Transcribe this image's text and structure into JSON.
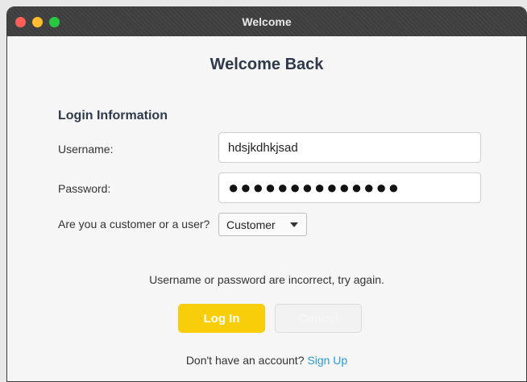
{
  "window": {
    "title": "Welcome",
    "controls": [
      "close",
      "minimize",
      "zoom"
    ]
  },
  "heading": "Welcome Back",
  "form": {
    "section_label": "Login Information",
    "username_label": "Username:",
    "username_value": "hdsjkdhkjsad",
    "password_label": "Password:",
    "password_masked": "●●●●●●●●●●●●●●",
    "type_label": "Are you a customer or a user?",
    "type_selected": "Customer"
  },
  "error_message": "Username or password are incorrect, try again.",
  "buttons": {
    "login": "Log In",
    "cancel": "Cancel"
  },
  "footer": {
    "prompt": "Don't have an account?",
    "signup_link": "Sign Up"
  },
  "colors": {
    "login_button": "#f8ce0a",
    "link": "#2b9bd6",
    "heading": "#2e3a4a"
  }
}
